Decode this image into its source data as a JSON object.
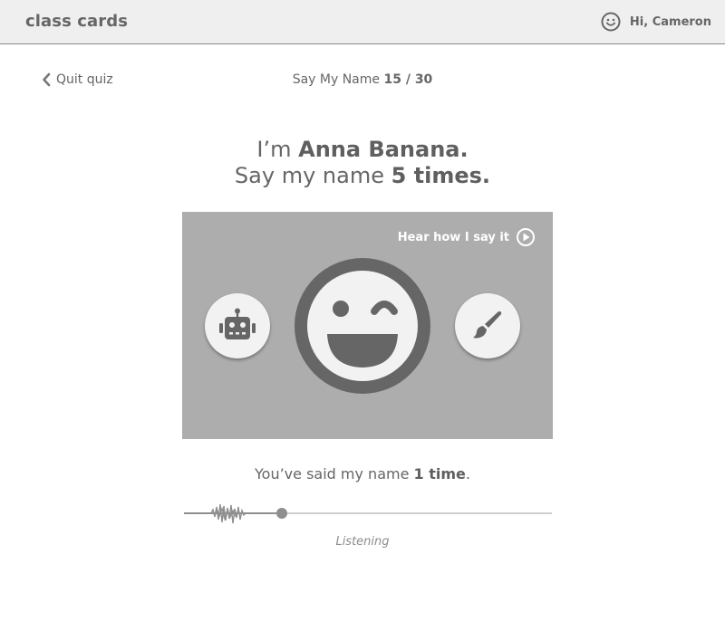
{
  "header": {
    "app_title": "class cards",
    "greeting": "Hi, Cameron",
    "user_icon": "smiley-face-icon"
  },
  "nav": {
    "quit_label": "Quit quiz",
    "quit_icon": "chevron-left-icon"
  },
  "quiz": {
    "name": "Say My Name",
    "progress": "15 / 30"
  },
  "prompt": {
    "line1_prefix": "I’m ",
    "line1_name": "Anna Banana.",
    "line2_prefix": "Say my name ",
    "line2_count": "5 times."
  },
  "card": {
    "hear_label": "Hear how I say it",
    "hear_icon": "play-circle-icon",
    "left_button_icon": "robot-icon",
    "right_button_icon": "paintbrush-icon",
    "center_icon": "winking-face-icon",
    "background_color": "#adadad"
  },
  "status": {
    "said_prefix": "You’ve said my name ",
    "said_count": "1 time",
    "said_suffix": ".",
    "listening_label": "Listening",
    "progress_fraction": 0.27
  }
}
